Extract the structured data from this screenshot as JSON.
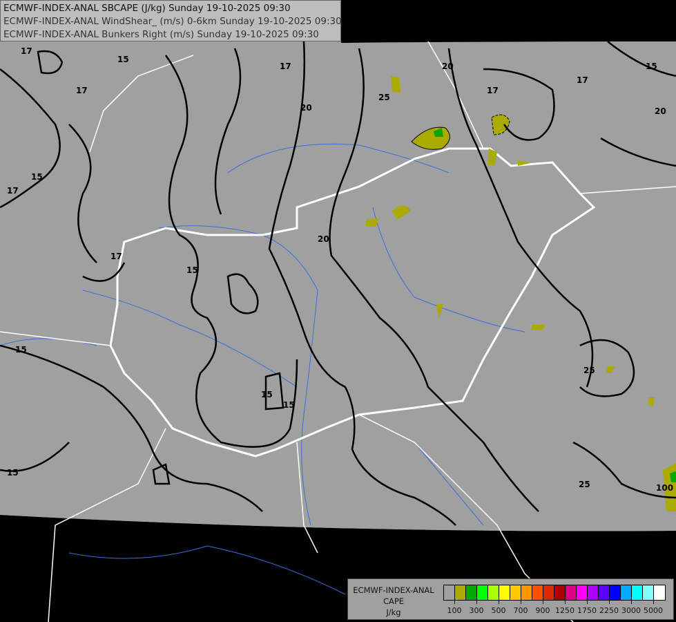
{
  "titles": [
    "ECMWF-INDEX-ANAL SBCAPE (J/kg) Sunday 19-10-2025 09:30",
    "ECMWF-INDEX-ANAL WindShear_ (m/s) 0-6km Sunday 19-10-2025 09:30",
    "ECMWF-INDEX-ANAL Bunkers Right (m/s) Sunday 19-10-2025 09:30"
  ],
  "legend": {
    "title_lines": [
      "ECMWF-INDEX-ANAL",
      "CAPE",
      "J/kg"
    ],
    "colors": [
      "#a0a0a0",
      "#aaaa00",
      "#00aa00",
      "#00ff00",
      "#aaff00",
      "#ffff00",
      "#ffc800",
      "#ff9600",
      "#ff5000",
      "#dc2800",
      "#aa0000",
      "#dc0082",
      "#ff00ff",
      "#aa00ff",
      "#5a00ff",
      "#0000ff",
      "#00aaff",
      "#00ffff",
      "#80ffff",
      "#ffffff"
    ],
    "tick_labels": [
      "100",
      "300",
      "500",
      "700",
      "900",
      "1250",
      "1750",
      "2250",
      "3000",
      "5000"
    ]
  },
  "contour_labels": [
    "17",
    "15",
    "17",
    "17",
    "15",
    "17",
    "20",
    "17",
    "20",
    "15",
    "17",
    "20",
    "15",
    "17",
    "15",
    "15",
    "15",
    "20",
    "25",
    "25",
    "25",
    "15",
    "100"
  ],
  "colors": {
    "background_field": "#a0a0a0",
    "outside": "#000000",
    "borders": "#ffffff",
    "rivers": "#3a6fd8",
    "contours": "#000000",
    "cape_low": "#aaaa00",
    "cape_mid": "#00aa00"
  }
}
